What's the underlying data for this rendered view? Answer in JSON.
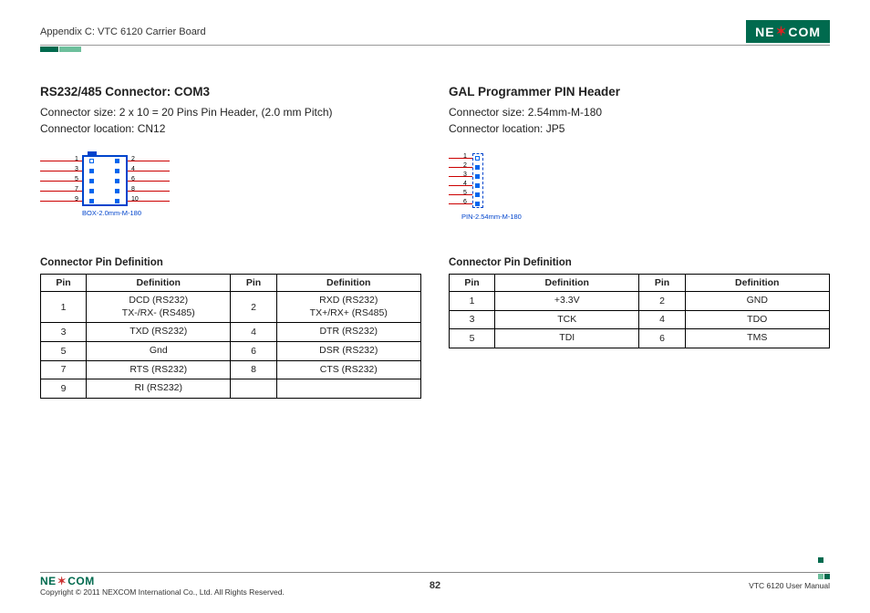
{
  "header": {
    "appendix": "Appendix C: VTC 6120 Carrier Board",
    "logo_text_pre": "NE",
    "logo_text_mid": "X",
    "logo_text_post": "COM"
  },
  "left": {
    "title": "RS232/485 Connector: COM3",
    "size": "Connector size: 2 x 10 = 20 Pins Pin Header, (2.0 mm Pitch)",
    "location": "Connector location: CN12",
    "diagram_label": "BOX-2.0mm-M-180",
    "diagram_pins_left": [
      "1",
      "3",
      "5",
      "7",
      "9"
    ],
    "diagram_pins_right": [
      "2",
      "4",
      "6",
      "8",
      "10"
    ],
    "table_title": "Connector Pin Definition",
    "headers": [
      "Pin",
      "Definition",
      "Pin",
      "Definition"
    ],
    "rows": [
      {
        "p1": "1",
        "d1": "DCD (RS232)\nTX-/RX- (RS485)",
        "p2": "2",
        "d2": "RXD (RS232)\nTX+/RX+ (RS485)"
      },
      {
        "p1": "3",
        "d1": "TXD (RS232)",
        "p2": "4",
        "d2": "DTR (RS232)"
      },
      {
        "p1": "5",
        "d1": "Gnd",
        "p2": "6",
        "d2": "DSR (RS232)"
      },
      {
        "p1": "7",
        "d1": "RTS (RS232)",
        "p2": "8",
        "d2": "CTS (RS232)"
      },
      {
        "p1": "9",
        "d1": "RI (RS232)",
        "p2": "",
        "d2": ""
      }
    ]
  },
  "right": {
    "title": "GAL Programmer PIN Header",
    "size": "Connector size: 2.54mm-M-180",
    "location": "Connector location: JP5",
    "diagram_label": "PIN-2.54mm-M-180",
    "diagram_pins": [
      "1",
      "2",
      "3",
      "4",
      "5",
      "6"
    ],
    "table_title": "Connector Pin Definition",
    "headers": [
      "Pin",
      "Definition",
      "Pin",
      "Definition"
    ],
    "rows": [
      {
        "p1": "1",
        "d1": "+3.3V",
        "p2": "2",
        "d2": "GND"
      },
      {
        "p1": "3",
        "d1": "TCK",
        "p2": "4",
        "d2": "TDO"
      },
      {
        "p1": "5",
        "d1": "TDI",
        "p2": "6",
        "d2": "TMS"
      }
    ]
  },
  "footer": {
    "copyright": "Copyright © 2011 NEXCOM International Co., Ltd. All Rights Reserved.",
    "page": "82",
    "manual": "VTC 6120 User Manual"
  }
}
